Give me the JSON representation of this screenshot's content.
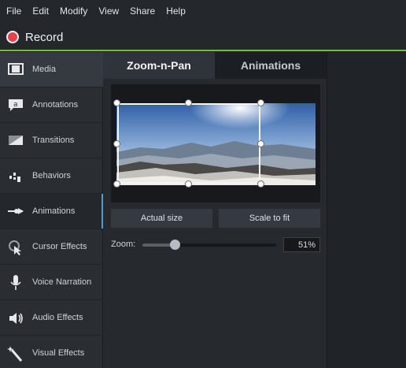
{
  "menu": [
    "File",
    "Edit",
    "Modify",
    "View",
    "Share",
    "Help"
  ],
  "record": {
    "label": "Record",
    "color": "#e8424b"
  },
  "accent": "#6fc02c",
  "sidebar": {
    "items": [
      {
        "label": "Media",
        "icon": "film-icon"
      },
      {
        "label": "Annotations",
        "icon": "annotation-icon"
      },
      {
        "label": "Transitions",
        "icon": "transition-icon"
      },
      {
        "label": "Behaviors",
        "icon": "behaviors-icon"
      },
      {
        "label": "Animations",
        "icon": "animation-arrow-icon"
      },
      {
        "label": "Cursor Effects",
        "icon": "cursor-icon"
      },
      {
        "label": "Voice Narration",
        "icon": "microphone-icon"
      },
      {
        "label": "Audio Effects",
        "icon": "speaker-icon"
      },
      {
        "label": "Visual Effects",
        "icon": "magic-wand-icon"
      }
    ],
    "active_index": 0,
    "selected_index": 4
  },
  "tabs": [
    {
      "label": "Zoom-n-Pan",
      "active": true
    },
    {
      "label": "Animations",
      "active": false
    }
  ],
  "buttons": {
    "actual_size": "Actual size",
    "scale_to_fit": "Scale to fit"
  },
  "zoom": {
    "label": "Zoom:",
    "value_text": "51%",
    "value": 0.51
  }
}
